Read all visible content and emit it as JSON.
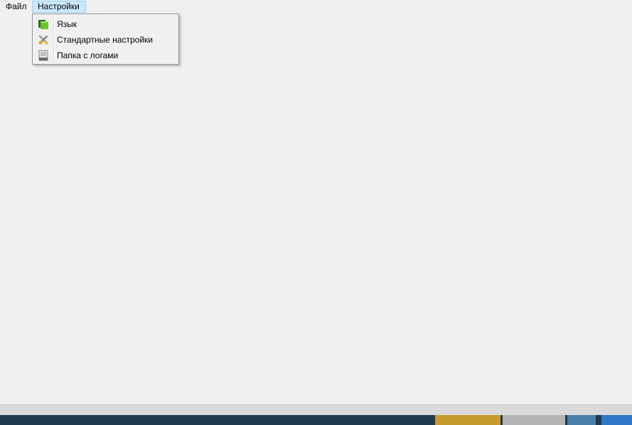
{
  "menubar": {
    "file_label": "Файл",
    "settings_label": "Настройки"
  },
  "settings_menu": {
    "items": [
      {
        "label": "Язык",
        "icon": "language-icon"
      },
      {
        "label": "Стандартные настройки",
        "icon": "default-settings-icon"
      },
      {
        "label": "Папка с логами",
        "icon": "log-folder-icon"
      }
    ]
  },
  "colors": {
    "background": "#f0f0f0",
    "menu_highlight": "#cce8ff",
    "menu_highlight_border": "#99d1ff",
    "dropdown_border": "#979797",
    "taskbar": "#1f3a4e"
  }
}
